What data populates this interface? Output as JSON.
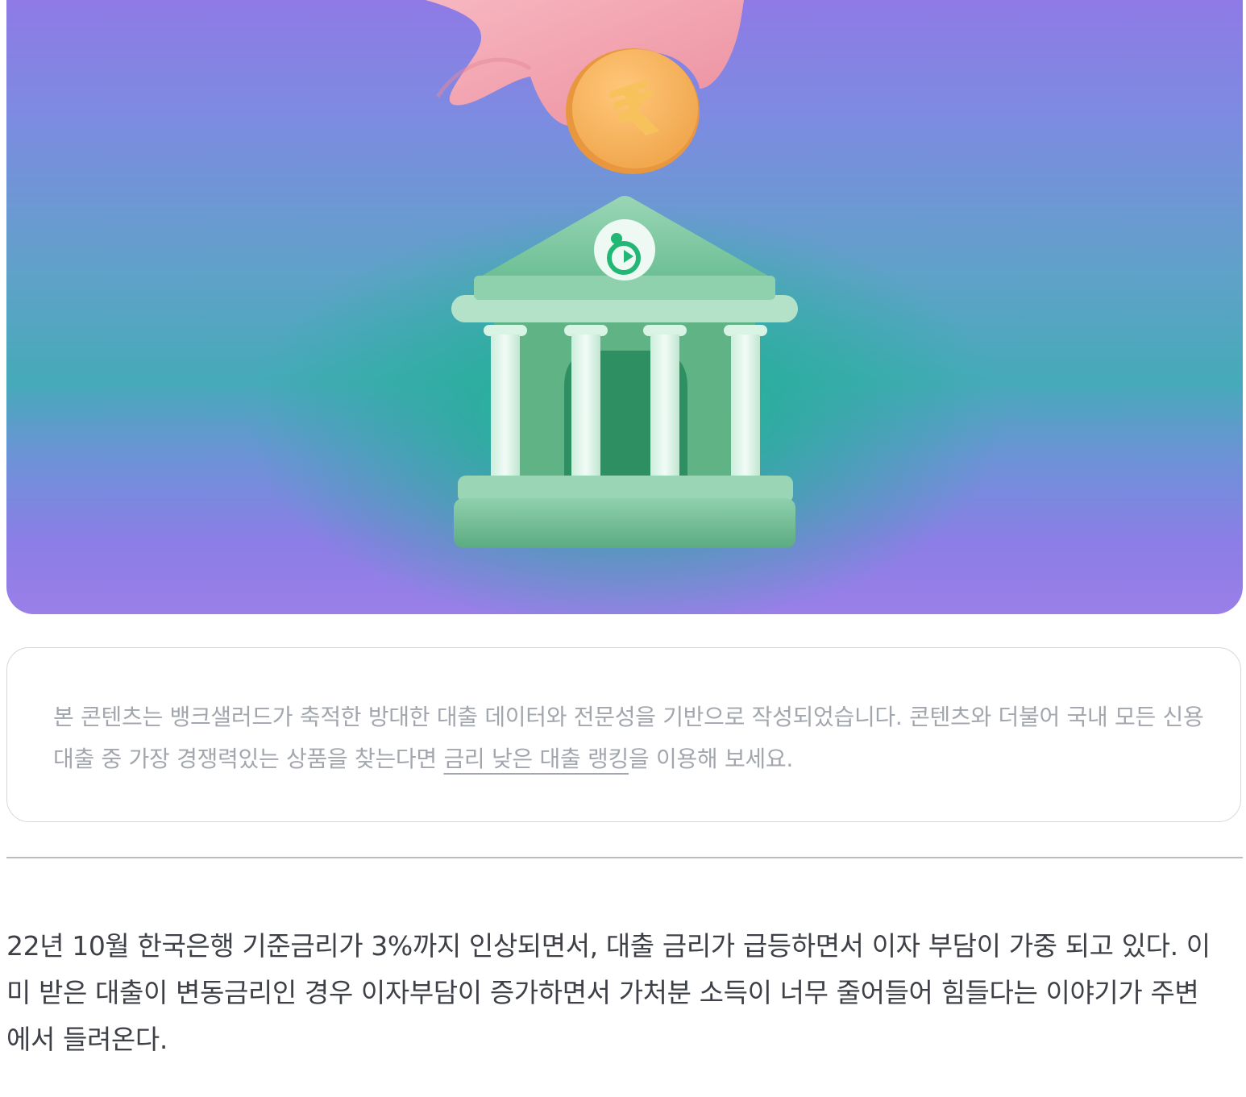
{
  "hero": {
    "coin_symbol": "₹",
    "colors": {
      "background_purple": "#9a7fe8",
      "glow_green": "#14cd8c",
      "bank_green": "#6fc29a",
      "coin_orange": "#f6b35a",
      "hand_pink": "#f2a6b1"
    }
  },
  "notice": {
    "text_before_link": "본 콘텐츠는 뱅크샐러드가 축적한 방대한 대출 데이터와 전문성을 기반으로 작성되었습니다. 콘텐츠와 더불어 국내 모든 신용대출 중 가장 경쟁력있는 상품을 찾는다면 ",
    "link_text": "금리 낮은 대출 랭킹",
    "text_after_link": "을 이용해 보세요."
  },
  "article": {
    "paragraph": " 22년 10월 한국은행 기준금리가 3%까지 인상되면서, 대출 금리가 급등하면서 이자 부담이 가중 되고 있다. 이미 받은 대출이 변동금리인 경우 이자부담이 증가하면서 가처분 소득이 너무 줄어들어 힘들다는 이야기가 주변에서 들려온다."
  }
}
